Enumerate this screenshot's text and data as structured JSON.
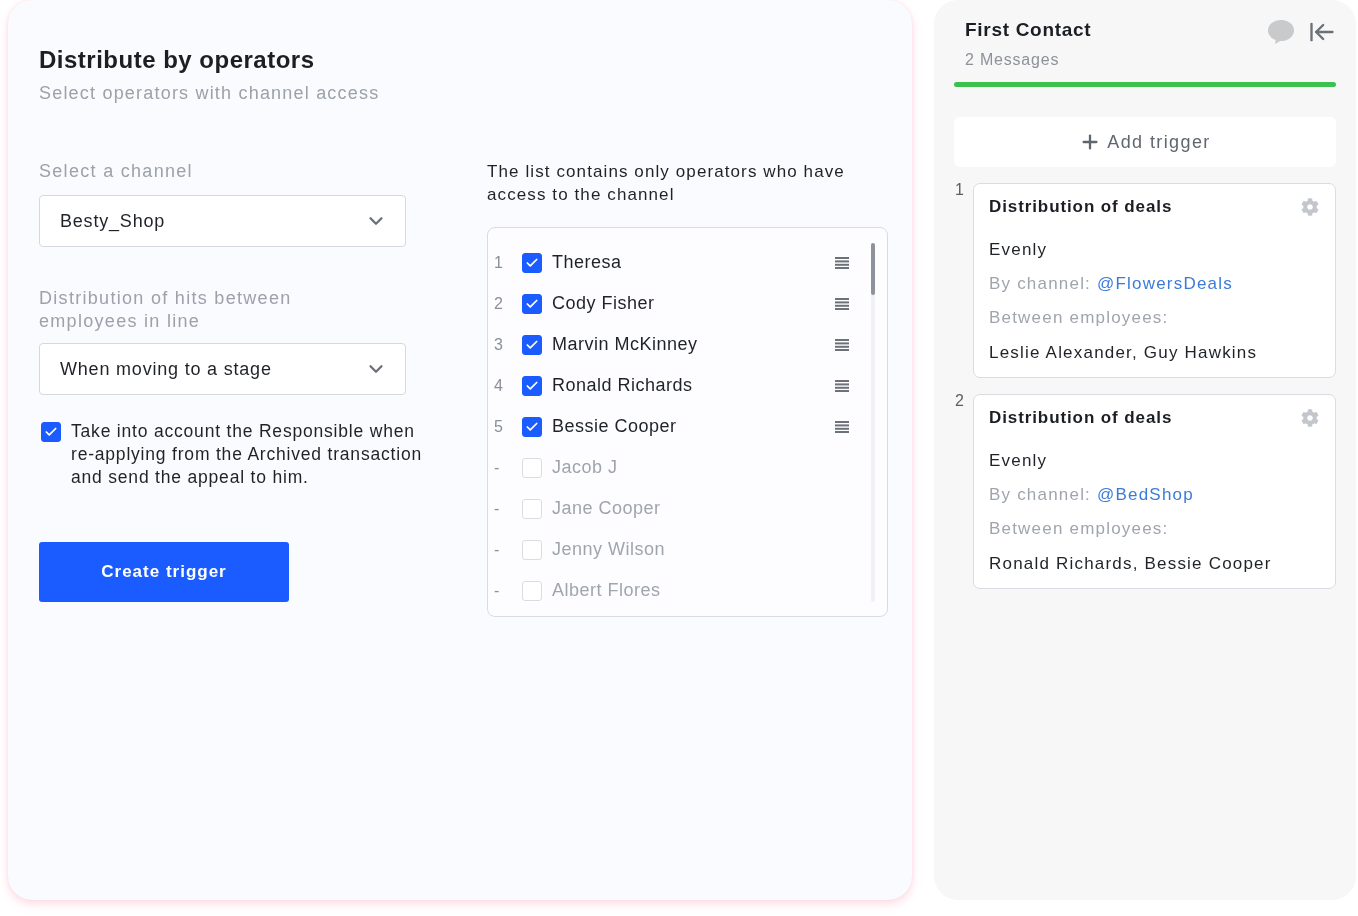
{
  "main": {
    "title": "Distribute by operators",
    "subtitle": "Select operators with channel access"
  },
  "form": {
    "fields": [
      {
        "label": "Select a channel",
        "value": "Besty_Shop"
      },
      {
        "label": "Distribution of hits between employees in line",
        "value": "When moving to a stage"
      }
    ],
    "option": {
      "checked": true,
      "label": "Take into account the Responsible when re-applying from the Archived transaction and send the appeal to him."
    },
    "submit": "Create trigger"
  },
  "operators": {
    "note": "The list contains only operators who have access to the channel",
    "items": [
      {
        "number": "1",
        "name": "Theresa",
        "checked": true
      },
      {
        "number": "2",
        "name": "Cody Fisher",
        "checked": true
      },
      {
        "number": "3",
        "name": "Marvin McKinney",
        "checked": true
      },
      {
        "number": "4",
        "name": "Ronald Richards",
        "checked": true
      },
      {
        "number": "5",
        "name": "Bessie Cooper",
        "checked": true
      },
      {
        "number": "-",
        "name": "Jacob J",
        "checked": false
      },
      {
        "number": "-",
        "name": "Jane Cooper",
        "checked": false
      },
      {
        "number": "-",
        "name": "Jenny Wilson",
        "checked": false
      },
      {
        "number": "-",
        "name": "Albert Flores",
        "checked": false
      }
    ]
  },
  "stage": {
    "title": "First Contact",
    "count": "2 Messages",
    "add_trigger": "Add trigger",
    "triggers": [
      {
        "number": "1",
        "title": "Distribution of deals",
        "mode": "Evenly",
        "channel_label": "By channel:",
        "channel": "@FlowersDeals",
        "employees_label": "Between employees:",
        "employees": "Leslie Alexander, Guy Hawkins"
      },
      {
        "number": "2",
        "title": "Distribution of deals",
        "mode": "Evenly",
        "channel_label": "By channel:",
        "channel": "@BedShop",
        "employees_label": "Between employees:",
        "employees": "Ronald Richards, Bessie Cooper"
      }
    ]
  }
}
